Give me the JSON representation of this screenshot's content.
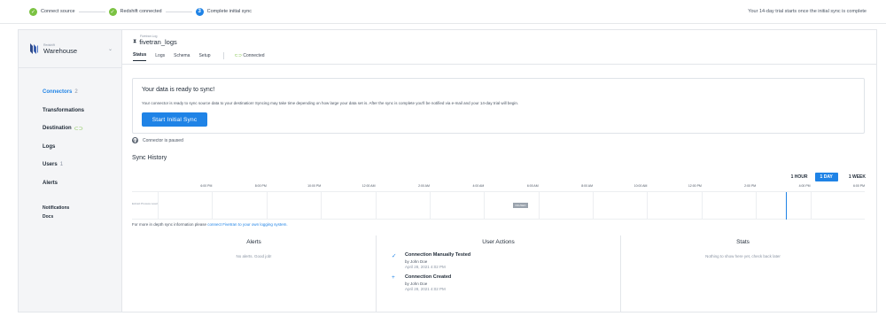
{
  "steps": [
    {
      "label": "Connect source",
      "state": "done"
    },
    {
      "label": "Redshift connected",
      "state": "done"
    },
    {
      "label": "Complete initial sync",
      "state": "active",
      "number": "3"
    }
  ],
  "trial_note": "Your 14-day trial starts once the initial sync is complete",
  "workspace": {
    "small_label": "Redshift",
    "name": "Warehouse"
  },
  "sidebar": {
    "items": [
      {
        "label": "Connectors",
        "count": "2",
        "active": true
      },
      {
        "label": "Transformations"
      },
      {
        "label": "Destination",
        "status_icon": "link-icon"
      },
      {
        "label": "Logs"
      },
      {
        "label": "Users",
        "count": "1"
      },
      {
        "label": "Alerts"
      }
    ],
    "bottom_items": [
      {
        "label": "Notifications"
      },
      {
        "label": "Docs"
      }
    ]
  },
  "connector": {
    "small_label": "Fivetran Log",
    "title": "fivetran_logs"
  },
  "tabs": [
    {
      "label": "Status",
      "active": true
    },
    {
      "label": "Logs"
    },
    {
      "label": "Schema"
    },
    {
      "label": "Setup"
    }
  ],
  "connection_status": "Connected",
  "ready_card": {
    "title": "Your data is ready to sync!",
    "text": "Your connector is ready to sync source data to your destination! Syncing may take time depending on how large your data set is. After the sync is complete you'll be notified via e-mail and your 14-day trial will begin.",
    "button": "Start Initial Sync"
  },
  "paused_note": "Connector is paused",
  "sync_history": {
    "title": "Sync History",
    "ranges": [
      {
        "label": "1 HOUR"
      },
      {
        "label": "1 DAY",
        "active": true
      },
      {
        "label": "1 WEEK"
      }
    ],
    "time_labels": [
      "6:00 PM",
      "8:00 PM",
      "10:00 PM",
      "12:00 AM",
      "2:00 AM",
      "4:00 AM",
      "6:00 AM",
      "8:00 AM",
      "10:00 AM",
      "12:00 PM",
      "2:00 PM",
      "4:00 PM",
      "6:00 PM"
    ],
    "row_label": "Extract Process Load",
    "paused_badge": "PAUSED"
  },
  "more_info": {
    "prefix": "For more in depth sync information please ",
    "link": "connect Fivetran to your own logging system."
  },
  "alerts": {
    "title": "Alerts",
    "empty": "No alerts. Good job!"
  },
  "user_actions": {
    "title": "User Actions",
    "items": [
      {
        "icon": "check-icon",
        "title": "Connection Manually Tested",
        "by": "by John Doe",
        "date": "April 28, 2021 4:02 PM"
      },
      {
        "icon": "plus-icon",
        "title": "Connection Created",
        "by": "by John Doe",
        "date": "April 28, 2021 4:02 PM"
      }
    ]
  },
  "stats": {
    "title": "Stats",
    "empty": "Nothing to show here yet, check back later"
  },
  "colors": {
    "accent": "#1f83e6",
    "success": "#7bc242"
  }
}
